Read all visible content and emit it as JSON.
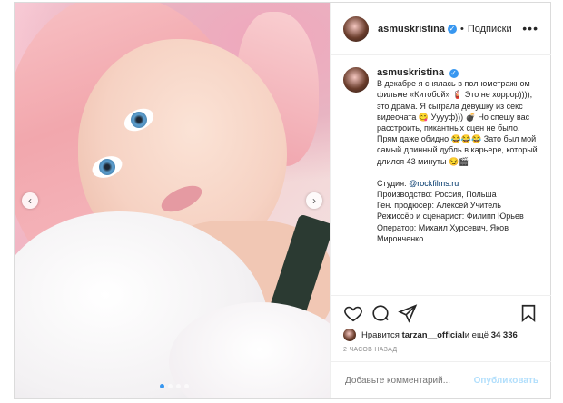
{
  "post": {
    "username": "asmuskristina",
    "separator": "•",
    "follow_label": "Подписки",
    "more_label": "•••",
    "verified_glyph": "✓",
    "caption": {
      "username": "asmuskristina",
      "line1": "В декабре я снялась в полнометражном фильме «Китобой» 🧯 Это не хоррор)))), это драма. Я сыграла девушку из секс видеочата 😋 Ууууф))) 💣 Но спешу вас расстроить, пикантных сцен не было. Прям даже обидно 😂😂😂 Зато был мой самый длинный дубль в карьере, который длился 43 минуты 😏🎬",
      "studio_label": "Студия: ",
      "studio_link": "@rockfilms.ru",
      "production": "Производство: Россия, Польша",
      "producer": "Ген. продюсер: Алексей Учитель",
      "director": "Режиссёр и сценарист: Филипп Юрьев",
      "operator": "Оператор: Михаил Хурсевич, Яков Миронченко"
    },
    "likes": {
      "prefix": "Нравится ",
      "user": "tarzan__official",
      "middle": " и ещё ",
      "count": "34 336"
    },
    "time": "2 ЧАСОВ НАЗАД",
    "comment_placeholder": "Добавьте комментарий...",
    "publish_label": "Опубликовать",
    "nav_prev": "‹",
    "nav_next": "›"
  },
  "icons": [
    "verified-icon",
    "more-icon",
    "heart-icon",
    "comment-icon",
    "share-icon",
    "save-icon",
    "prev-arrow-icon",
    "next-arrow-icon"
  ],
  "colors": {
    "accent": "#3897f0",
    "text": "#262626",
    "muted": "#8e8e8e",
    "link": "#00376b",
    "publish_disabled": "#b2dffc",
    "border": "#dbdbdb"
  },
  "carousel": {
    "total": 4,
    "current": 1
  }
}
